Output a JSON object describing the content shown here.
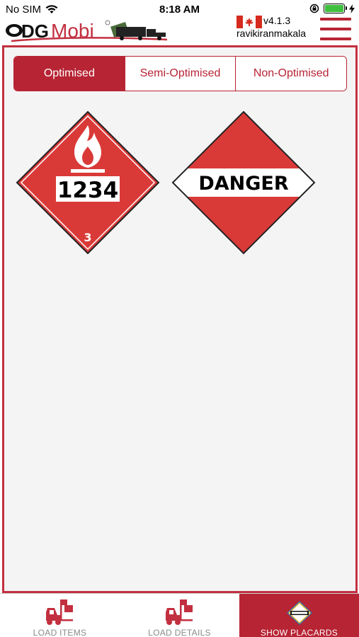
{
  "status_bar": {
    "carrier": "No SIM",
    "time": "8:18 AM"
  },
  "header": {
    "logo_text_dg": "DG",
    "logo_text_mobi": "Mobi",
    "version": "v4.1.3",
    "username": "ravikiranmakala"
  },
  "segments": [
    {
      "label": "Optimised",
      "active": true
    },
    {
      "label": "Semi-Optimised",
      "active": false
    },
    {
      "label": "Non-Optimised",
      "active": false
    }
  ],
  "placards": {
    "flammable": {
      "un_number": "1234",
      "class_number": "3"
    },
    "danger": {
      "text": "DANGER"
    }
  },
  "tabs": [
    {
      "label": "LOAD ITEMS",
      "icon": "forklift-icon",
      "active": false
    },
    {
      "label": "LOAD DETAILS",
      "icon": "forklift-icon",
      "active": false
    },
    {
      "label": "SHOW PLACARDS",
      "icon": "danger-placard-icon",
      "active": true
    }
  ],
  "colors": {
    "brand_red": "#b72434",
    "placard_red": "#d93a38",
    "battery_green": "#3fc03f"
  }
}
